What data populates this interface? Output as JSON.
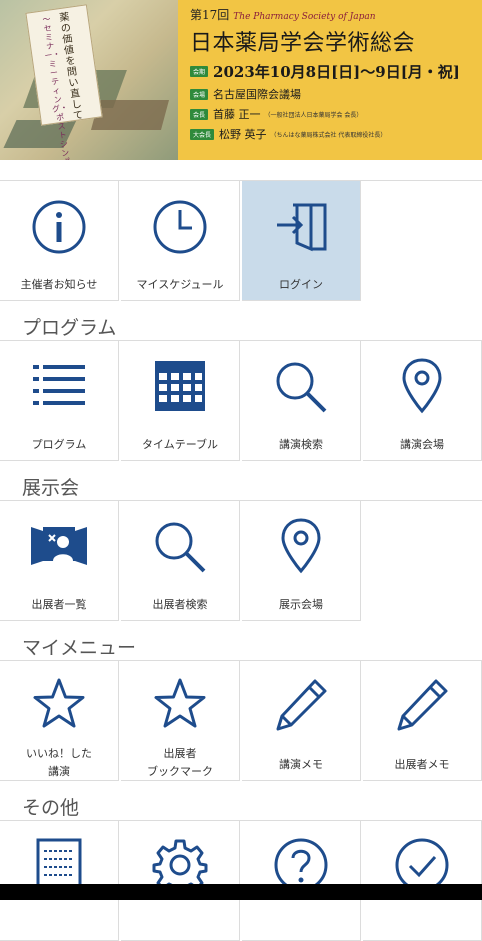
{
  "banner": {
    "scroll_text_main": "薬の価値を問い直して",
    "scroll_text_sub": "〜セミナー・ミーティング・ポストシンポジウム・アジェンダ〜",
    "edition": "第17回",
    "society_en": "The Pharmacy Society of Japan",
    "title": "日本薬局学会学術総会",
    "date_tag": "会期",
    "date": "2023年10月8日[日]〜9日[月・祝]",
    "venue_tag": "会場",
    "venue": "名古屋国際会議場",
    "chair_tag": "会長",
    "chair": "首藤 正一",
    "chair_note": "（一般社団法人日本薬局学会 会長）",
    "president_tag": "大会長",
    "president": "松野 英子",
    "president_note": "（ちんはな薬局株式会社 代表取締役社長）",
    "colors": {
      "background": "#f2c544",
      "tag": "#2f8a3b"
    }
  },
  "top": [
    {
      "label": "主催者お知らせ",
      "icon": "info-icon"
    },
    {
      "label": "マイスケジュール",
      "icon": "clock-icon"
    },
    {
      "label": "ログイン",
      "icon": "login-icon",
      "selected": true
    }
  ],
  "sections": {
    "program": {
      "title": "プログラム",
      "items": [
        {
          "label": "プログラム",
          "icon": "list-icon"
        },
        {
          "label": "タイムテーブル",
          "icon": "calendar-grid-icon"
        },
        {
          "label": "講演検索",
          "icon": "search-icon"
        },
        {
          "label": "講演会場",
          "icon": "map-pin-icon"
        }
      ]
    },
    "exhibit": {
      "title": "展示会",
      "items": [
        {
          "label": "出展者一覧",
          "icon": "exhibitor-booth-icon"
        },
        {
          "label": "出展者検索",
          "icon": "search-icon"
        },
        {
          "label": "展示会場",
          "icon": "map-pin-icon"
        }
      ]
    },
    "mymenu": {
      "title": "マイメニュー",
      "items": [
        {
          "label_line1": "いいね！した",
          "label_line2": "講演",
          "icon": "star-icon"
        },
        {
          "label_line1": "出展者",
          "label_line2": "ブックマーク",
          "icon": "star-icon"
        },
        {
          "label": "講演メモ",
          "icon": "pencil-icon"
        },
        {
          "label": "出展者メモ",
          "icon": "pencil-icon"
        }
      ]
    },
    "other": {
      "title": "その他",
      "items": [
        {
          "icon": "document-icon"
        },
        {
          "icon": "gear-icon"
        },
        {
          "icon": "help-icon"
        },
        {
          "icon": "check-circle-icon"
        }
      ]
    }
  },
  "colors": {
    "icon": "#1e4c8c",
    "selected_tile": "#c9dbea",
    "divider": "#dcdcdc"
  }
}
